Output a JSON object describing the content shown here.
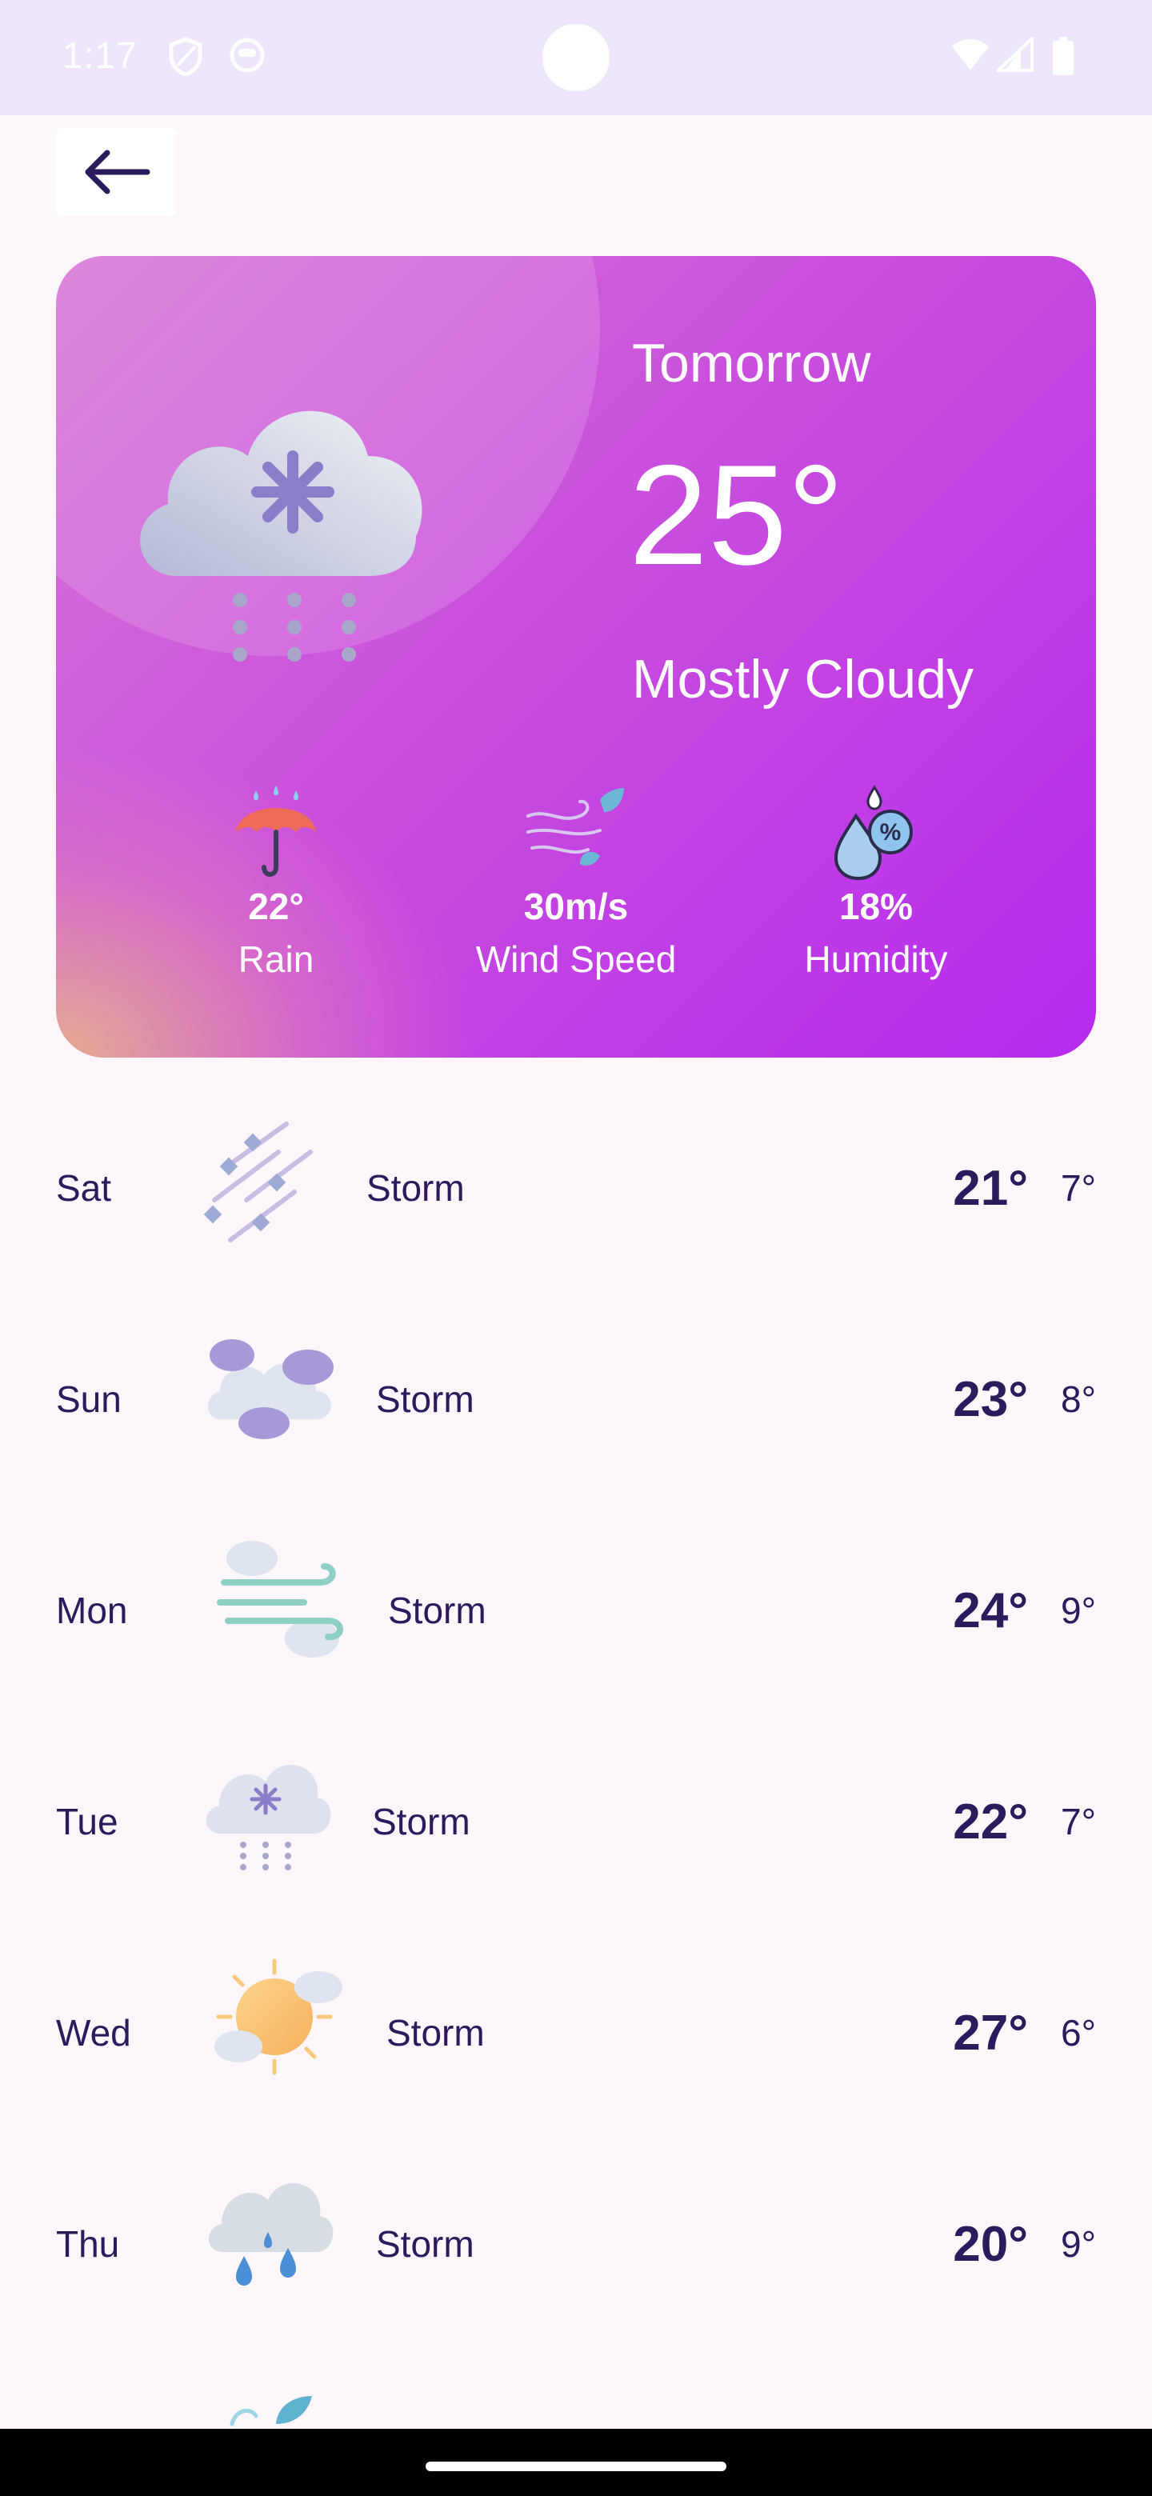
{
  "status_bar": {
    "time": "1:17"
  },
  "hero": {
    "day": "Tomorrow",
    "temperature": "25°",
    "condition": "Mostly Cloudy",
    "stats": [
      {
        "value": "22°",
        "label": "Rain",
        "icon": "umbrella-icon"
      },
      {
        "value": "30m/s",
        "label": "Wind Speed",
        "icon": "wind-icon"
      },
      {
        "value": "18%",
        "label": "Humidity",
        "icon": "humidity-icon"
      }
    ]
  },
  "forecast": [
    {
      "day": "Sat",
      "condition": "Storm",
      "high": "21°",
      "low": "7°",
      "icon": "storm-hail-icon"
    },
    {
      "day": "Sun",
      "condition": "Storm",
      "high": "23°",
      "low": "8°",
      "icon": "clouds-icon"
    },
    {
      "day": "Mon",
      "condition": "Storm",
      "high": "24°",
      "low": "9°",
      "icon": "wind-clouds-icon"
    },
    {
      "day": "Tue",
      "condition": "Storm",
      "high": "22°",
      "low": "7°",
      "icon": "snow-cloud-icon"
    },
    {
      "day": "Wed",
      "condition": "Storm",
      "high": "27°",
      "low": "6°",
      "icon": "sun-clouds-icon"
    },
    {
      "day": "Thu",
      "condition": "Storm",
      "high": "20°",
      "low": "9°",
      "icon": "rain-cloud-icon"
    }
  ],
  "colors": {
    "text": "#2b1a5c",
    "card_start": "#d774d6",
    "card_end": "#b62bee",
    "background": "#fdf7fc"
  }
}
